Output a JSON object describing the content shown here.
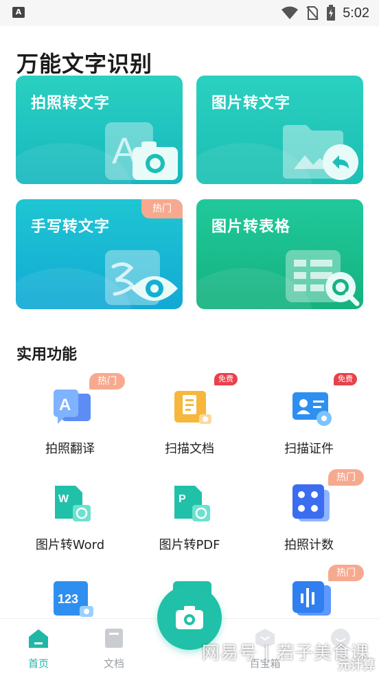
{
  "status_bar": {
    "time": "5:02",
    "app_icon_letter": "A",
    "icons": [
      "wifi-icon",
      "no-sim-icon",
      "battery-charging-icon"
    ]
  },
  "page_title": "万能文字识别",
  "cards": [
    {
      "label": "拍照转文字",
      "icon": "photo-to-text-icon",
      "color_top": "#2ad0c0",
      "color_bottom": "#17b7bf"
    },
    {
      "label": "图片转文字",
      "icon": "image-to-text-icon",
      "color_top": "#2ad0c0",
      "color_bottom": "#1cbfb3"
    },
    {
      "label": "手写转文字",
      "icon": "handwriting-to-text-icon",
      "badge": "热门",
      "color_top": "#1fc6d2",
      "color_bottom": "#12a9d5"
    },
    {
      "label": "图片转表格",
      "icon": "image-to-table-icon",
      "color_top": "#20c99a",
      "color_bottom": "#15b17f"
    }
  ],
  "section_title": "实用功能",
  "features": [
    {
      "name": "拍照翻译",
      "icon": "photo-translate-icon",
      "badge": "热门",
      "badge_type": "hot"
    },
    {
      "name": "扫描文档",
      "icon": "scan-document-icon",
      "badge": "免费",
      "badge_type": "free"
    },
    {
      "name": "扫描证件",
      "icon": "scan-id-icon",
      "badge": "免费",
      "badge_type": "free"
    },
    {
      "name": "图片转Word",
      "icon": "image-to-word-icon"
    },
    {
      "name": "图片转PDF",
      "icon": "image-to-pdf-icon"
    },
    {
      "name": "拍照计数",
      "icon": "photo-count-icon",
      "badge": "热门",
      "badge_type": "hot"
    },
    {
      "name": "",
      "icon": "number-recognition-icon"
    },
    {
      "name": "",
      "icon": "eye-scan-icon"
    },
    {
      "name": "",
      "icon": "audio-to-text-icon",
      "badge": "热门",
      "badge_type": "hot"
    }
  ],
  "nav": {
    "tabs": [
      {
        "label": "首页",
        "icon": "home-icon",
        "active": true
      },
      {
        "label": "文档",
        "icon": "document-icon",
        "active": false
      },
      {
        "label": "百宝箱",
        "icon": "toolbox-icon",
        "active": false
      },
      {
        "label": "",
        "icon": "profile-icon",
        "active": false
      }
    ],
    "fab_icon": "camera-icon"
  },
  "watermark": {
    "line1": "网易号 | 若子美食课",
    "line2": "元计算"
  },
  "colors": {
    "accent": "#20c1a8",
    "hot_badge": "#f7a98f",
    "free_badge": "#e9414b"
  }
}
